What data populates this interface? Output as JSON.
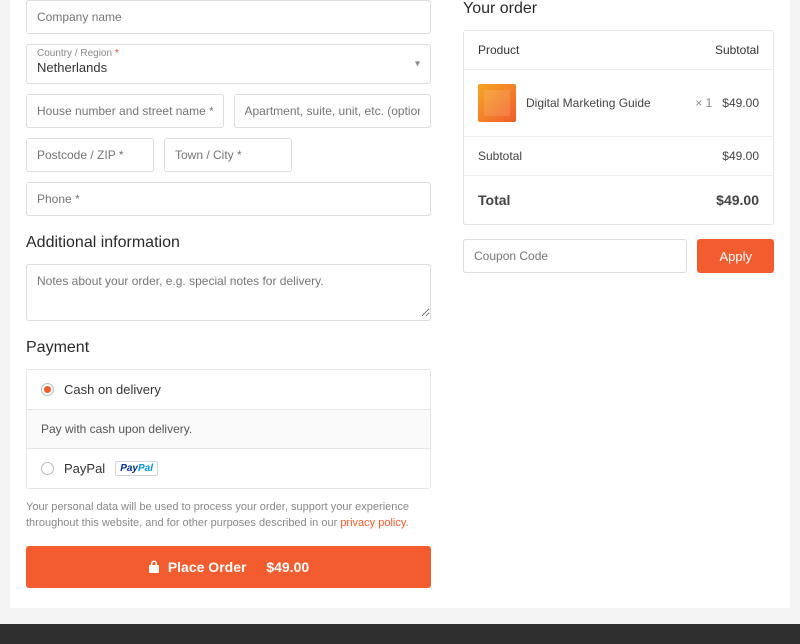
{
  "billing": {
    "company_placeholder": "Company name",
    "country_label": "Country / Region",
    "country_value": "Netherlands",
    "street_placeholder": "House number and street name *",
    "apartment_placeholder": "Apartment, suite, unit, etc. (optional)",
    "postcode_placeholder": "Postcode / ZIP *",
    "city_placeholder": "Town / City *",
    "phone_placeholder": "Phone *"
  },
  "additional": {
    "heading": "Additional information",
    "notes_placeholder": "Notes about your order, e.g. special notes for delivery."
  },
  "payment": {
    "heading": "Payment",
    "cod_label": "Cash on delivery",
    "cod_desc": "Pay with cash upon delivery.",
    "paypal_label": "PayPal"
  },
  "privacy": {
    "text": "Your personal data will be used to process your order, support your experience throughout this website, and for other purposes described in our ",
    "link": "privacy policy"
  },
  "place_order": {
    "label": "Place Order",
    "amount": "$49.00"
  },
  "order": {
    "heading": "Your order",
    "product_col": "Product",
    "subtotal_col": "Subtotal",
    "item_name": "Digital Marketing Guide",
    "item_qty": "× 1",
    "item_price": "$49.00",
    "subtotal_label": "Subtotal",
    "subtotal_value": "$49.00",
    "total_label": "Total",
    "total_value": "$49.00"
  },
  "coupon": {
    "placeholder": "Coupon Code",
    "apply": "Apply"
  }
}
